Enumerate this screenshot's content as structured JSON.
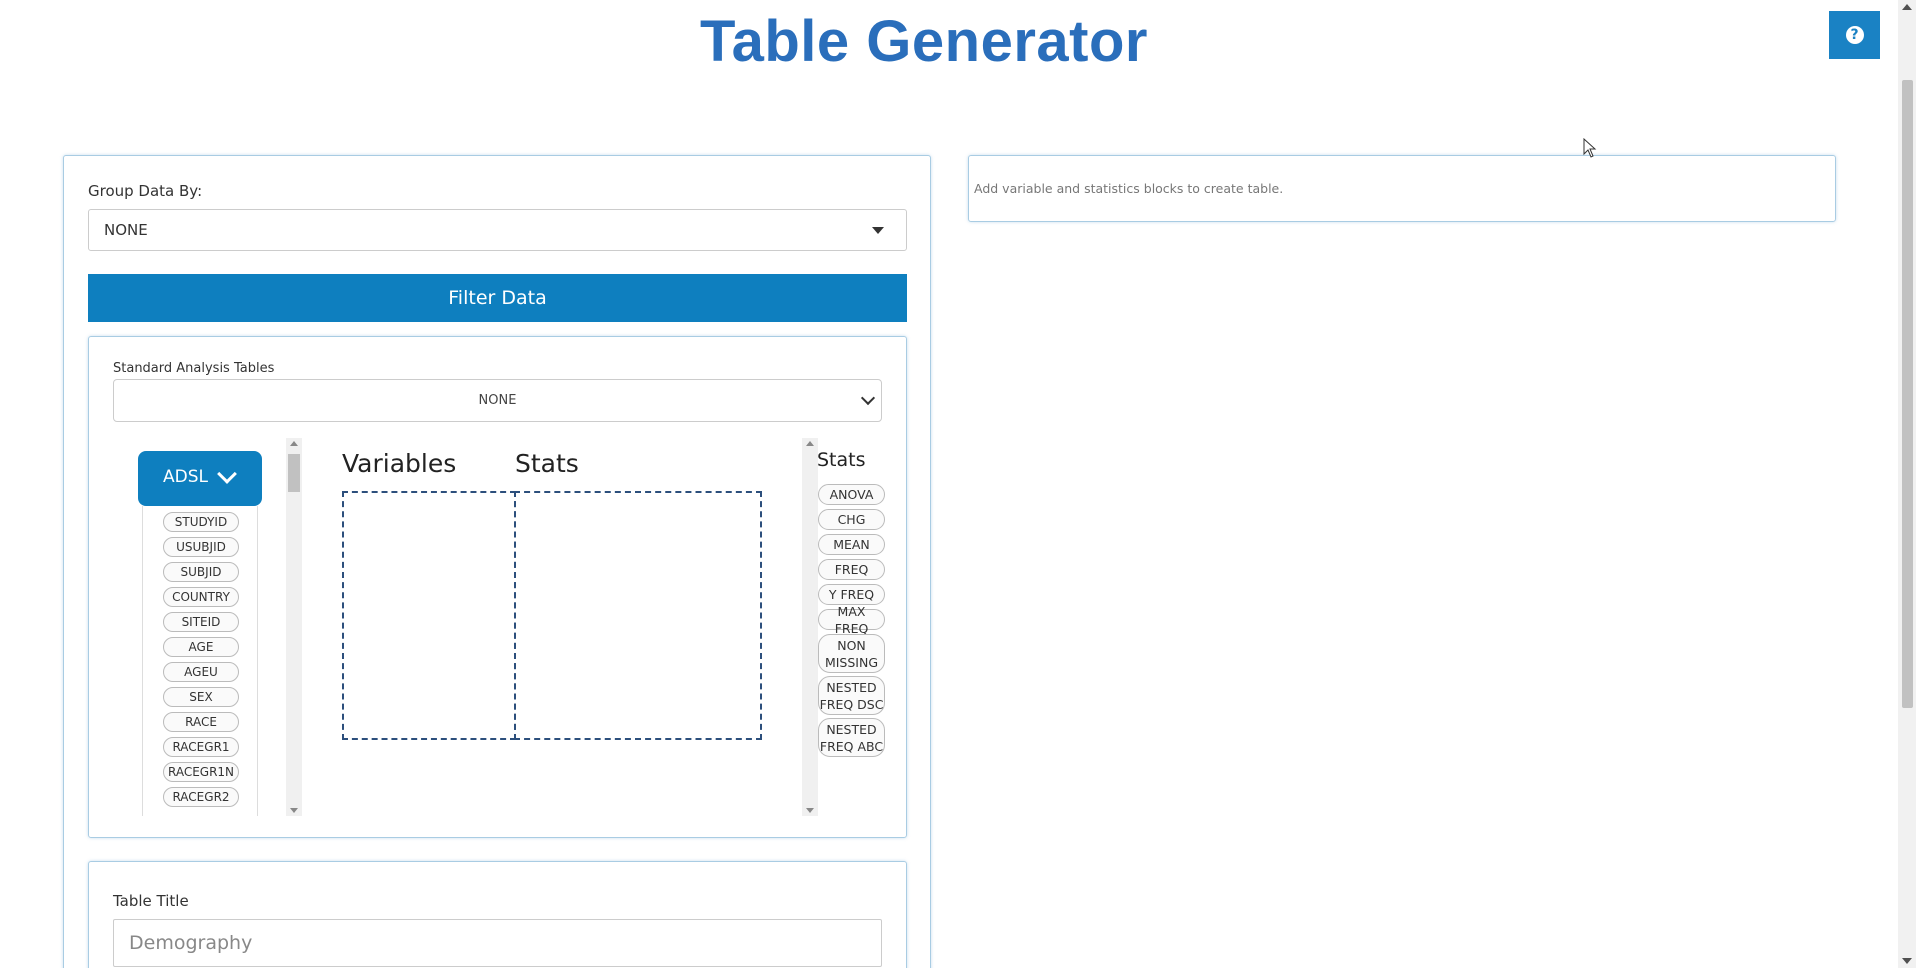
{
  "header": {
    "title": "Table Generator",
    "help_icon": "question-circle-icon",
    "accent_color": "#2a6ebb"
  },
  "left_panel": {
    "group_label": "Group Data By:",
    "group_value": "NONE",
    "filter_button": "Filter Data",
    "standard_tables_label": "Standard Analysis Tables",
    "standard_tables_value": "NONE",
    "dataset": {
      "name": "ADSL",
      "variables": [
        "STUDYID",
        "USUBJID",
        "SUBJID",
        "COUNTRY",
        "SITEID",
        "AGE",
        "AGEU",
        "SEX",
        "RACE",
        "RACEGR1",
        "RACEGR1N",
        "RACEGR2"
      ]
    },
    "drop_zone": {
      "variables_header": "Variables",
      "stats_header": "Stats"
    },
    "stats_palette": {
      "title": "Stats",
      "items": [
        "ANOVA",
        "CHG",
        "MEAN",
        "FREQ",
        "Y FREQ",
        "MAX FREQ",
        "NON\nMISSING",
        "NESTED\nFREQ DSC",
        "NESTED\nFREQ ABC"
      ]
    },
    "table_title": {
      "label": "Table Title",
      "placeholder": "Demography"
    }
  },
  "right_panel": {
    "hint": "Add variable and statistics blocks to create table."
  },
  "colors": {
    "primary_button": "#0e7fbf",
    "panel_border": "#a9cce3",
    "drop_zone_border": "#2c4f7c"
  }
}
